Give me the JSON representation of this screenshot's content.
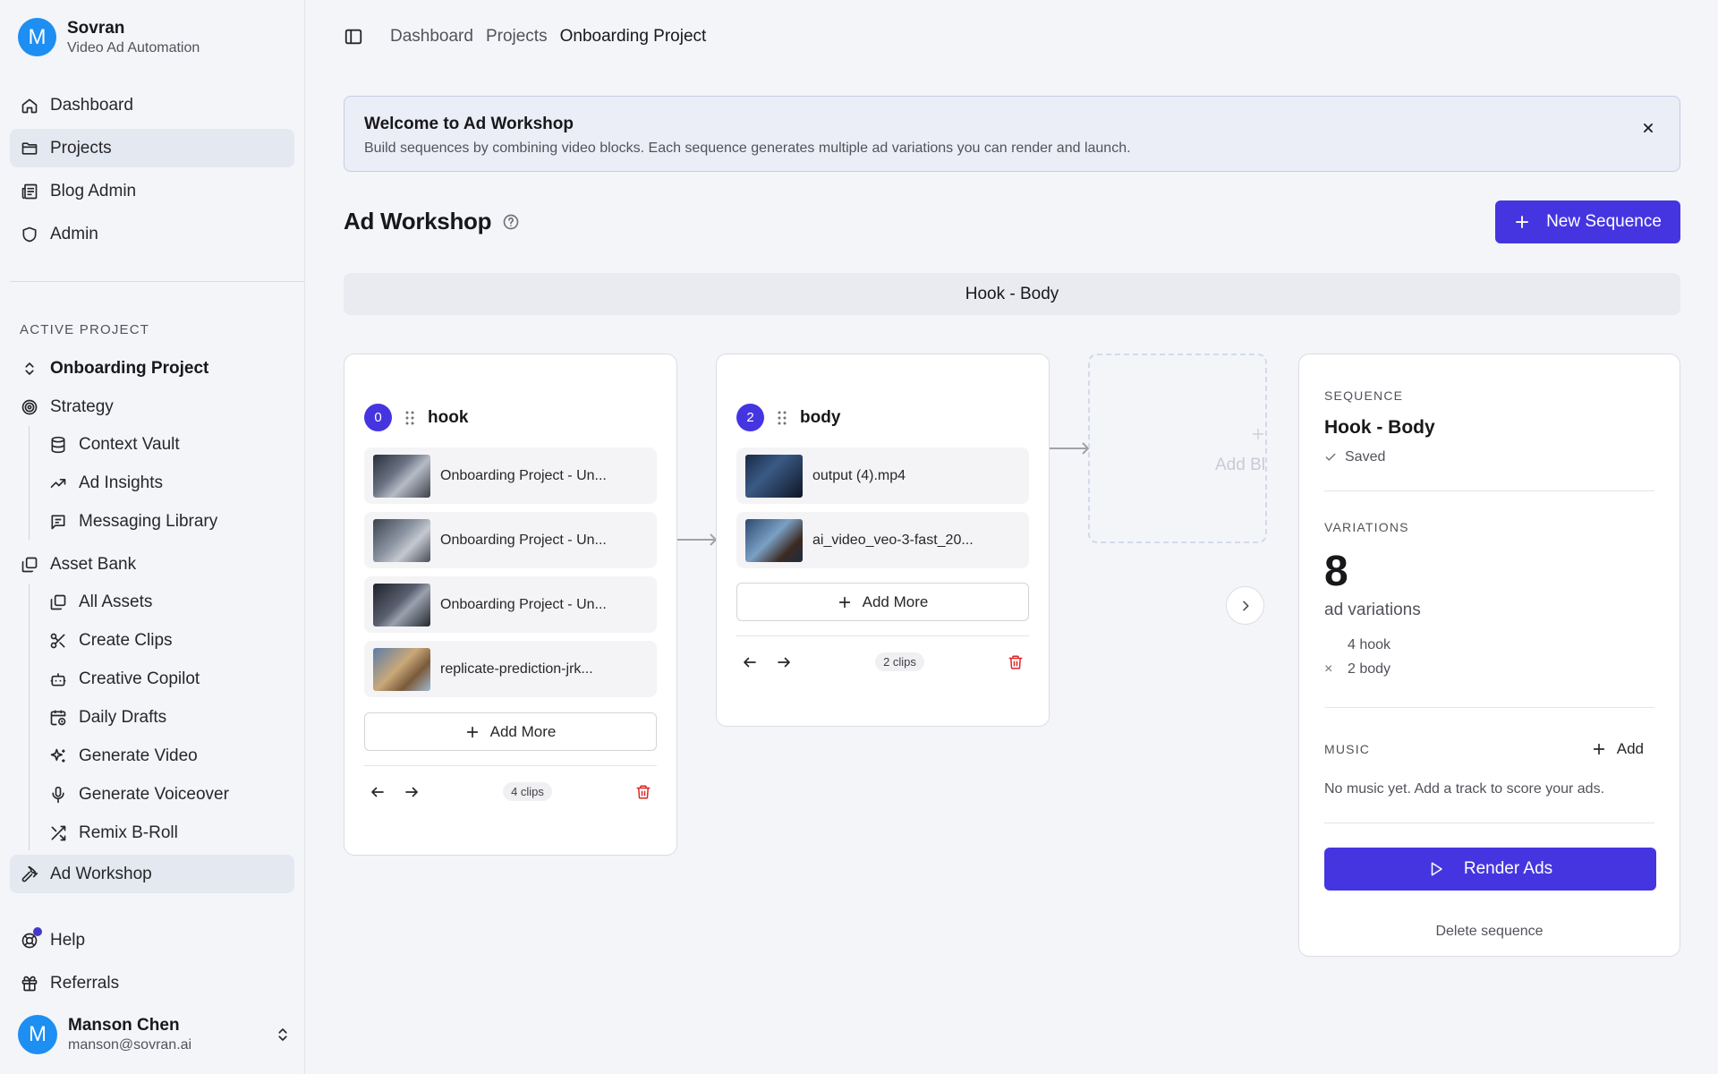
{
  "brand": {
    "avatar_letter": "M",
    "name": "Sovran",
    "subtitle": "Video Ad Automation"
  },
  "nav": {
    "dashboard": "Dashboard",
    "projects": "Projects",
    "blog_admin": "Blog Admin",
    "admin": "Admin"
  },
  "active_project": {
    "section_label": "ACTIVE PROJECT",
    "project_name": "Onboarding Project",
    "strategy": "Strategy",
    "context_vault": "Context Vault",
    "ad_insights": "Ad Insights",
    "messaging_library": "Messaging Library",
    "asset_bank": "Asset Bank",
    "all_assets": "All Assets",
    "create_clips": "Create Clips",
    "creative_copilot": "Creative Copilot",
    "daily_drafts": "Daily Drafts",
    "generate_video": "Generate Video",
    "generate_voiceover": "Generate Voiceover",
    "remix_broll": "Remix B-Roll",
    "ad_workshop": "Ad Workshop"
  },
  "footer_nav": {
    "help": "Help",
    "referrals": "Referrals"
  },
  "user": {
    "avatar_letter": "M",
    "name": "Manson Chen",
    "email": "manson@sovran.ai"
  },
  "breadcrumb": [
    "Dashboard",
    "Projects",
    "Onboarding Project"
  ],
  "banner": {
    "title": "Welcome to Ad Workshop",
    "text": "Build sequences by combining video blocks. Each sequence generates multiple ad variations you can render and launch."
  },
  "page": {
    "title": "Ad Workshop",
    "new_sequence_label": "New Sequence"
  },
  "sequence_tab": "Hook - Body",
  "blocks": [
    {
      "index": "0",
      "name": "hook",
      "clips": [
        "Onboarding Project - Un...",
        "Onboarding Project - Un...",
        "Onboarding Project - Un...",
        "replicate-prediction-jrk..."
      ],
      "add_more": "Add More",
      "count": "4 clips"
    },
    {
      "index": "2",
      "name": "body",
      "clips": [
        "output (4).mp4",
        "ai_video_veo-3-fast_20..."
      ],
      "add_more": "Add More",
      "count": "2 clips"
    }
  ],
  "ghost_block_label": "Add Bl",
  "panel": {
    "sequence_label": "SEQUENCE",
    "sequence_name": "Hook - Body",
    "saved": "Saved",
    "variations_label": "VARIATIONS",
    "variations_count": "8",
    "variations_sub": "ad variations",
    "breakdown": [
      {
        "mult": "",
        "text": "4 hook"
      },
      {
        "mult": "×",
        "text": "2 body"
      }
    ],
    "music_label": "MUSIC",
    "music_add": "Add",
    "music_empty": "No music yet. Add a track to score your ads.",
    "render_label": "Render Ads",
    "delete_label": "Delete sequence"
  },
  "colors": {
    "accent": "#4535e0",
    "avatar": "#1d8ef2",
    "danger": "#dc2626"
  }
}
